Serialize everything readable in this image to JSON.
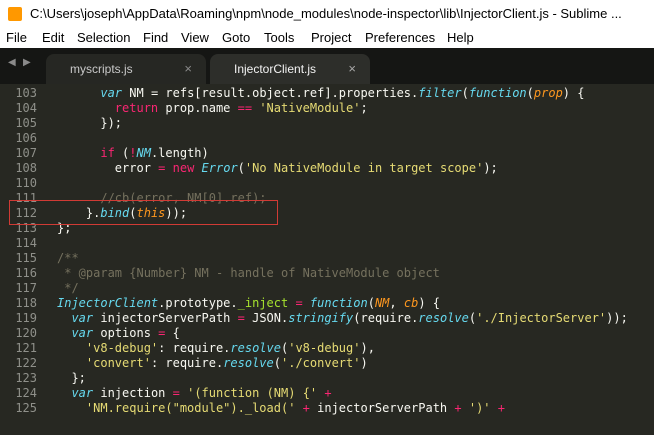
{
  "window": {
    "title": "C:\\Users\\joseph\\AppData\\Roaming\\npm\\node_modules\\node-inspector\\lib\\InjectorClient.js - Sublime ..."
  },
  "menu": {
    "file": "File",
    "edit": "Edit",
    "selection": "Selection",
    "find": "Find",
    "view": "View",
    "goto": "Goto",
    "tools": "Tools",
    "project": "Project",
    "preferences": "Preferences",
    "help": "Help"
  },
  "tabs": {
    "nav_left": "◀",
    "nav_right": "▶",
    "myscripts": {
      "label": "myscripts.js",
      "close": "×"
    },
    "injectorclient": {
      "label": "InjectorClient.js",
      "close": "×"
    }
  },
  "editor": {
    "lines": [
      {
        "n": "103",
        "parts": [
          {
            "t": "      "
          },
          {
            "t": "var",
            "c": "k-fn"
          },
          {
            "t": " NM = refs[result.object.ref].properties."
          },
          {
            "t": "filter",
            "c": "k-fn"
          },
          {
            "t": "("
          },
          {
            "t": "function",
            "c": "k-fn"
          },
          {
            "t": "("
          },
          {
            "t": "prop",
            "c": "k-arg"
          },
          {
            "t": ") {"
          }
        ]
      },
      {
        "n": "104",
        "parts": [
          {
            "t": "        "
          },
          {
            "t": "return",
            "c": "k-kw"
          },
          {
            "t": " prop.name "
          },
          {
            "t": "==",
            "c": "k-kw"
          },
          {
            "t": " "
          },
          {
            "t": "'NativeModule'",
            "c": "k-str"
          },
          {
            "t": ";"
          }
        ]
      },
      {
        "n": "105",
        "parts": [
          {
            "t": "      });"
          }
        ]
      },
      {
        "n": "106",
        "parts": []
      },
      {
        "n": "107",
        "parts": [
          {
            "t": "      "
          },
          {
            "t": "if",
            "c": "k-kw"
          },
          {
            "t": " ("
          },
          {
            "t": "!",
            "c": "k-kw"
          },
          {
            "t": "NM",
            "c": "k-fn"
          },
          {
            "t": ".length)"
          }
        ]
      },
      {
        "n": "108",
        "parts": [
          {
            "t": "        error "
          },
          {
            "t": "=",
            "c": "k-kw"
          },
          {
            "t": " "
          },
          {
            "t": "new",
            "c": "k-kw"
          },
          {
            "t": " "
          },
          {
            "t": "Error",
            "c": "k-fn"
          },
          {
            "t": "("
          },
          {
            "t": "'No NativeModule in target scope'",
            "c": "k-str"
          },
          {
            "t": ");"
          }
        ]
      },
      {
        "n": "110",
        "parts": []
      },
      {
        "n": "111",
        "parts": [
          {
            "t": "      "
          },
          {
            "t": "//cb(error, NM[0].ref);",
            "c": "k-com"
          }
        ]
      },
      {
        "n": "112",
        "parts": [
          {
            "t": "    }."
          },
          {
            "t": "bind",
            "c": "k-fn"
          },
          {
            "t": "("
          },
          {
            "t": "this",
            "c": "k-arg"
          },
          {
            "t": "));"
          }
        ]
      },
      {
        "n": "113",
        "parts": [
          {
            "t": "};"
          }
        ]
      },
      {
        "n": "114",
        "parts": []
      },
      {
        "n": "115",
        "parts": [
          {
            "t": "/**",
            "c": "k-com"
          }
        ]
      },
      {
        "n": "116",
        "parts": [
          {
            "t": " * @param {Number} NM - handle of NativeModule object",
            "c": "k-com"
          }
        ]
      },
      {
        "n": "117",
        "parts": [
          {
            "t": " */",
            "c": "k-com"
          }
        ]
      },
      {
        "n": "118",
        "parts": [
          {
            "t": "InjectorClient",
            "c": "k-fn"
          },
          {
            "t": ".prototype."
          },
          {
            "t": "_inject",
            "c": "k-prop"
          },
          {
            "t": " "
          },
          {
            "t": "=",
            "c": "k-kw"
          },
          {
            "t": " "
          },
          {
            "t": "function",
            "c": "k-fn"
          },
          {
            "t": "("
          },
          {
            "t": "NM",
            "c": "k-arg"
          },
          {
            "t": ", "
          },
          {
            "t": "cb",
            "c": "k-arg"
          },
          {
            "t": ") {"
          }
        ]
      },
      {
        "n": "119",
        "parts": [
          {
            "t": "  "
          },
          {
            "t": "var",
            "c": "k-fn"
          },
          {
            "t": " injectorServerPath "
          },
          {
            "t": "=",
            "c": "k-kw"
          },
          {
            "t": " JSON."
          },
          {
            "t": "stringify",
            "c": "k-fn"
          },
          {
            "t": "(require."
          },
          {
            "t": "resolve",
            "c": "k-fn"
          },
          {
            "t": "("
          },
          {
            "t": "'./InjectorServer'",
            "c": "k-str"
          },
          {
            "t": "));"
          }
        ]
      },
      {
        "n": "120",
        "parts": [
          {
            "t": "  "
          },
          {
            "t": "var",
            "c": "k-fn"
          },
          {
            "t": " options "
          },
          {
            "t": "=",
            "c": "k-kw"
          },
          {
            "t": " {"
          }
        ]
      },
      {
        "n": "121",
        "parts": [
          {
            "t": "    "
          },
          {
            "t": "'v8-debug'",
            "c": "k-str"
          },
          {
            "t": ": require."
          },
          {
            "t": "resolve",
            "c": "k-fn"
          },
          {
            "t": "("
          },
          {
            "t": "'v8-debug'",
            "c": "k-str"
          },
          {
            "t": "),"
          }
        ]
      },
      {
        "n": "122",
        "parts": [
          {
            "t": "    "
          },
          {
            "t": "'convert'",
            "c": "k-str"
          },
          {
            "t": ": require."
          },
          {
            "t": "resolve",
            "c": "k-fn"
          },
          {
            "t": "("
          },
          {
            "t": "'./convert'",
            "c": "k-str"
          },
          {
            "t": ")"
          }
        ]
      },
      {
        "n": "123",
        "parts": [
          {
            "t": "  };"
          }
        ]
      },
      {
        "n": "124",
        "parts": [
          {
            "t": "  "
          },
          {
            "t": "var",
            "c": "k-fn"
          },
          {
            "t": " injection "
          },
          {
            "t": "=",
            "c": "k-kw"
          },
          {
            "t": " "
          },
          {
            "t": "'(function (NM) {'",
            "c": "k-str"
          },
          {
            "t": " "
          },
          {
            "t": "+",
            "c": "k-kw"
          }
        ]
      },
      {
        "n": "125",
        "parts": [
          {
            "t": "    "
          },
          {
            "t": "'NM.require(\"module\")._load('",
            "c": "k-str"
          },
          {
            "t": " "
          },
          {
            "t": "+",
            "c": "k-kw"
          },
          {
            "t": " injectorServerPath "
          },
          {
            "t": "+",
            "c": "k-kw"
          },
          {
            "t": " "
          },
          {
            "t": "')'",
            "c": "k-str"
          },
          {
            "t": " "
          },
          {
            "t": "+",
            "c": "k-kw"
          }
        ]
      }
    ]
  }
}
